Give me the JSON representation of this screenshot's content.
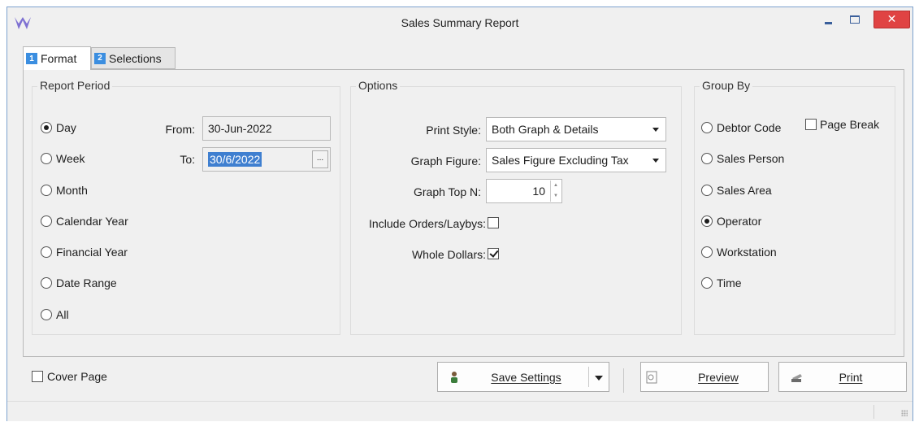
{
  "window": {
    "title": "Sales Summary Report"
  },
  "tabs": [
    {
      "num": "1",
      "label": "Format"
    },
    {
      "num": "2",
      "label": "Selections"
    }
  ],
  "report_period": {
    "title": "Report Period",
    "options": [
      "Day",
      "Week",
      "Month",
      "Calendar Year",
      "Financial Year",
      "Date Range",
      "All"
    ],
    "selected": "Day",
    "from_label": "From:",
    "from_value": "30-Jun-2022",
    "to_label": "To:",
    "to_value": "30/6/2022",
    "ellipsis": "..."
  },
  "options": {
    "title": "Options",
    "print_style_label": "Print Style:",
    "print_style_value": "Both Graph & Details",
    "graph_figure_label": "Graph Figure:",
    "graph_figure_value": "Sales Figure Excluding Tax",
    "graph_top_label": "Graph Top N:",
    "graph_top_value": "10",
    "include_orders_label": "Include Orders/Laybys:",
    "include_orders_checked": false,
    "whole_dollars_label": "Whole Dollars:",
    "whole_dollars_checked": true
  },
  "group_by": {
    "title": "Group By",
    "options": [
      "Debtor Code",
      "Sales Person",
      "Sales Area",
      "Operator",
      "Workstation",
      "Time"
    ],
    "selected": "Operator",
    "page_break_label": "Page Break",
    "page_break_checked": false
  },
  "footer": {
    "cover_page_label": "Cover Page",
    "cover_page_checked": false,
    "save_settings_label": "Save Settings",
    "preview_label": "Preview",
    "print_label": "Print"
  }
}
